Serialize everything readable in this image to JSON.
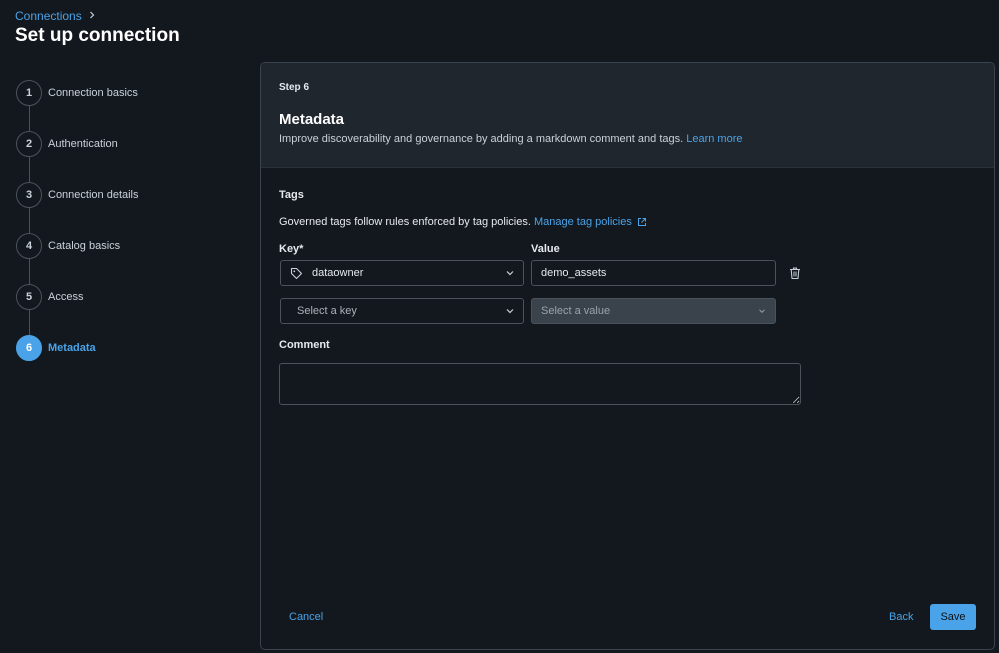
{
  "breadcrumb": {
    "parent": "Connections"
  },
  "page_title": "Set up connection",
  "steps": [
    {
      "number": "1",
      "label": "Connection basics"
    },
    {
      "number": "2",
      "label": "Authentication"
    },
    {
      "number": "3",
      "label": "Connection details"
    },
    {
      "number": "4",
      "label": "Catalog basics"
    },
    {
      "number": "5",
      "label": "Access"
    },
    {
      "number": "6",
      "label": "Metadata"
    }
  ],
  "active_step": "6",
  "panel": {
    "step_tag": "Step 6",
    "title": "Metadata",
    "description": "Improve discoverability and governance by adding a markdown comment and tags.",
    "learn_more": "Learn more",
    "tags_title": "Tags",
    "tags_desc": "Governed tags follow rules enforced by tag policies.",
    "manage_link": "Manage tag policies",
    "key_label": "Key*",
    "value_label": "Value",
    "rows": [
      {
        "key": "dataowner",
        "value": "demo_assets"
      },
      {
        "key_placeholder": "Select a key",
        "value_placeholder": "Select a value"
      }
    ],
    "comment_label": "Comment",
    "comment_value": ""
  },
  "footer": {
    "cancel": "Cancel",
    "back": "Back",
    "save": "Save"
  },
  "colors": {
    "accent": "#4aa3e8",
    "background": "#13181e",
    "panel_header": "#1f262d"
  },
  "icons": [
    "chevron-right-icon",
    "tag-icon",
    "chevron-down-icon",
    "trash-icon",
    "external-link-icon"
  ]
}
